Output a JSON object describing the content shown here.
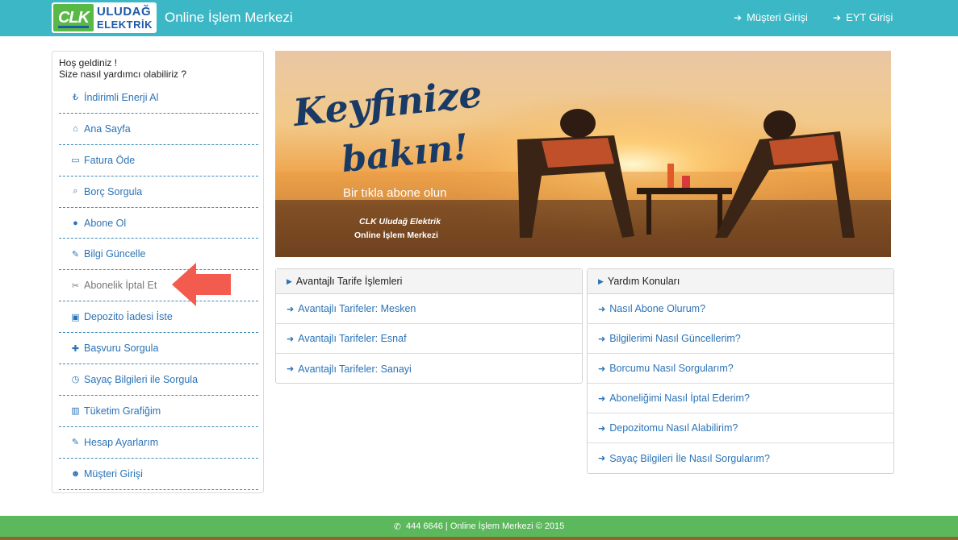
{
  "header": {
    "logo_clk": "CLK",
    "logo_line1": "ULUDAĞ",
    "logo_line2": "ELEKTRİK",
    "title": "Online İşlem Merkezi",
    "nav": [
      {
        "label": "Müşteri Girişi",
        "icon": "sign-in-icon"
      },
      {
        "label": "EYT Girişi",
        "icon": "sign-in-icon"
      }
    ]
  },
  "sidebar": {
    "greeting_line1": "Hoş geldiniz !",
    "greeting_line2": "Size nasıl yardımcı olabiliriz ?",
    "items": [
      {
        "label": "İndirimli Enerji Al",
        "icon": "lira-icon"
      },
      {
        "label": "Ana Sayfa",
        "icon": "home-icon"
      },
      {
        "label": "Fatura Öde",
        "icon": "credit-card-icon"
      },
      {
        "label": "Borç Sorgula",
        "icon": "search-icon"
      },
      {
        "label": "Abone Ol",
        "icon": "globe-icon"
      },
      {
        "label": "Bilgi Güncelle",
        "icon": "edit-icon"
      },
      {
        "label": "Abonelik İptal Et",
        "icon": "scissors-icon"
      },
      {
        "label": "Depozito İadesi İste",
        "icon": "money-icon"
      },
      {
        "label": "Başvuru Sorgula",
        "icon": "user-plus-icon"
      },
      {
        "label": "Sayaç Bilgileri ile Sorgula",
        "icon": "clock-icon"
      },
      {
        "label": "Tüketim Grafiğim",
        "icon": "bar-chart-icon"
      },
      {
        "label": "Hesap Ayarlarım",
        "icon": "edit-icon"
      },
      {
        "label": "Müşteri Girişi",
        "icon": "users-icon"
      }
    ]
  },
  "banner": {
    "headline1": "Keyfinize",
    "headline2": "bakın!",
    "subtitle": "Bir tıkla abone olun",
    "brand1": "CLK Uludağ Elektrik",
    "brand2": "Online İşlem Merkezi"
  },
  "tarife_panel": {
    "title": "Avantajlı Tarife İşlemleri",
    "items": [
      "Avantajlı Tarifeler: Mesken",
      "Avantajlı Tarifeler: Esnaf",
      "Avantajlı Tarifeler: Sanayi"
    ]
  },
  "yardim_panel": {
    "title": "Yardım Konuları",
    "items": [
      "Nasıl Abone Olurum?",
      "Bilgilerimi Nasıl Güncellerim?",
      "Borcumu Nasıl Sorgularım?",
      "Aboneliğimi Nasıl İptal Ederim?",
      "Depozitomu Nasıl Alabilirim?",
      "Sayaç Bilgileri İle Nasıl Sorgularım?"
    ]
  },
  "footer": {
    "text": "444 6646 | Online İşlem Merkezi © 2015"
  },
  "colors": {
    "header": "#3cb7c5",
    "link": "#2b73b7",
    "footer": "#5cb85c",
    "arrow": "#f45b4f"
  }
}
